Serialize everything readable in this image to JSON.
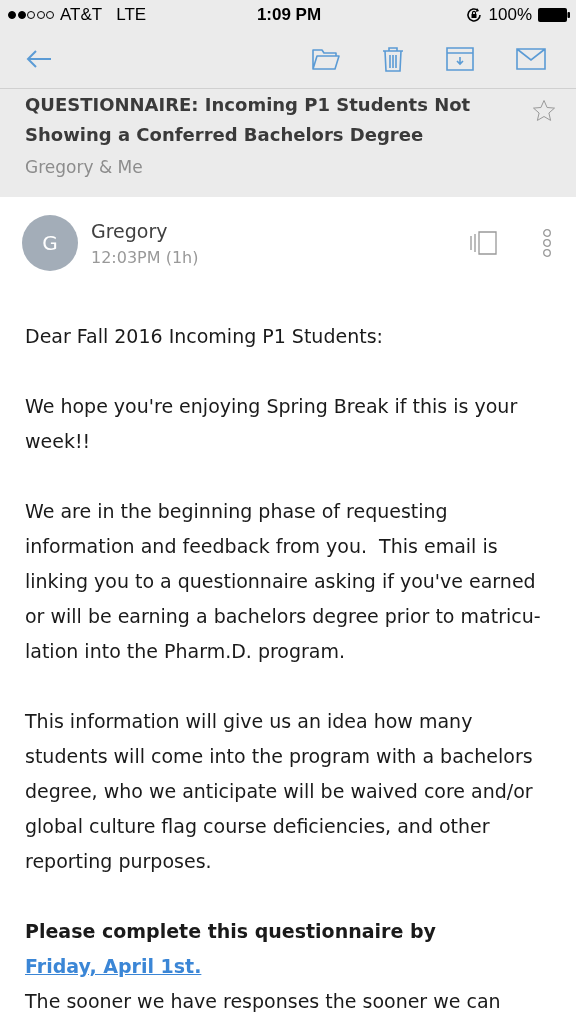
{
  "status_bar": {
    "carrier": "AT&T",
    "network": "LTE",
    "time": "1:09 PM",
    "battery": "100%"
  },
  "subject": {
    "title": "QUESTIONNAIRE: Incoming P1 Students Not Showing a Conferred Bachelors Degree",
    "participants": "Gregory & Me",
    "starred": false
  },
  "sender": {
    "initial": "G",
    "name": "Gregory",
    "time": "12:03PM (1h)"
  },
  "body": [
    {
      "kind": "text",
      "text": "Dear Fall 2016 Incoming P1 Students:"
    },
    {
      "kind": "text",
      "text": "We hope you're enjoying Spring Break if this is your week!!"
    },
    {
      "kind": "text",
      "text": "We are in the beginning phase of requesting information and feedback from you.  This email is linking you to a questionnaire asking if you've earned or will be earning a bachelors degree prior to matricu-lation into the Pharm.D. program."
    },
    {
      "kind": "text",
      "text": "This information will give us an idea how many students will come into the program with a bachelors degree, who we anticipate will be waived core and/or global culture flag course deficiencies, and other reporting purposes."
    },
    {
      "kind": "deadline",
      "text": "Please complete this questionnaire by",
      "link": "Friday, April 1st.",
      "after": "The sooner we have responses the sooner we can"
    }
  ]
}
